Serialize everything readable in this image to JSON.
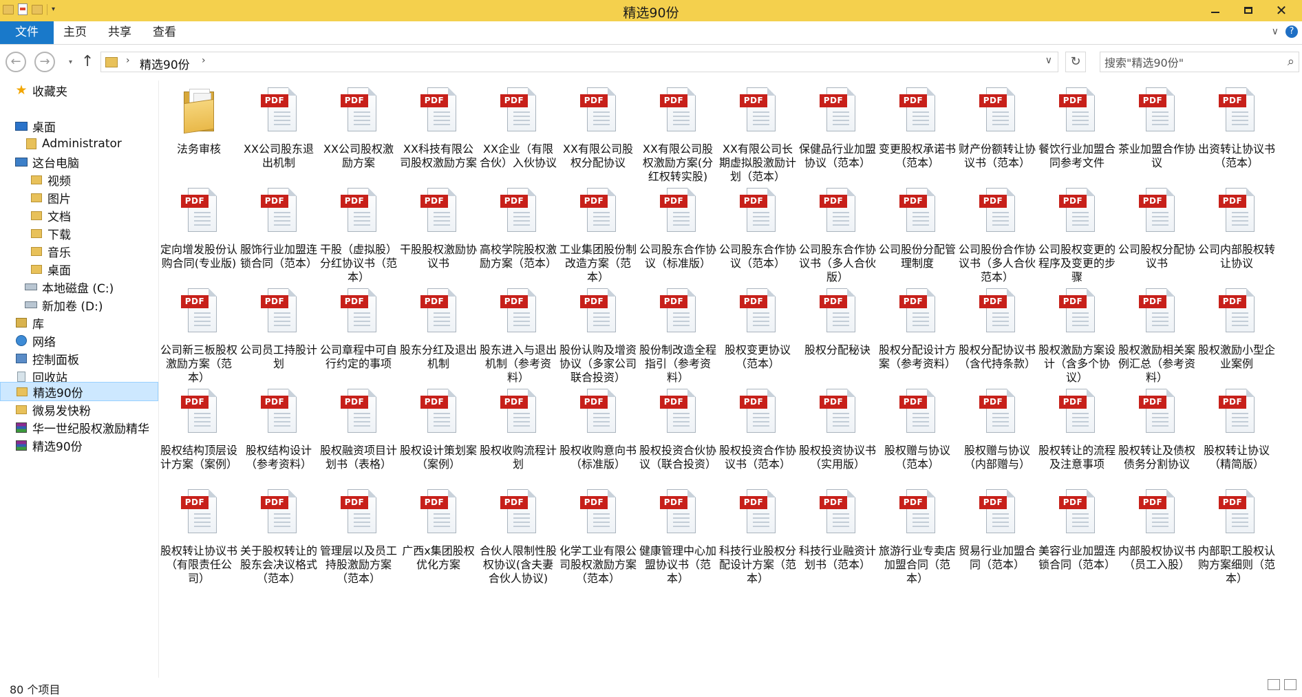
{
  "window": {
    "title": "精选90份",
    "controls": {
      "minimize": "—",
      "maximize": "❐",
      "close": "✕"
    }
  },
  "ribbon": {
    "tabs": [
      "文件",
      "主页",
      "共享",
      "查看"
    ]
  },
  "address": {
    "crumb": "精选90份",
    "search_placeholder": "搜索\"精选90份\""
  },
  "sidebar": {
    "items": [
      {
        "label": "收藏夹",
        "icon": "star-icon"
      },
      {
        "label": "桌面",
        "icon": "desktop-icon"
      },
      {
        "label": "Administrator",
        "icon": "user-folder-icon"
      },
      {
        "label": "这台电脑",
        "icon": "computer-icon"
      },
      {
        "label": "视频",
        "icon": "videos-folder-icon"
      },
      {
        "label": "图片",
        "icon": "pictures-folder-icon"
      },
      {
        "label": "文档",
        "icon": "documents-folder-icon"
      },
      {
        "label": "下载",
        "icon": "downloads-folder-icon"
      },
      {
        "label": "音乐",
        "icon": "music-folder-icon"
      },
      {
        "label": "桌面",
        "icon": "desktop-folder-icon"
      },
      {
        "label": "本地磁盘 (C:)",
        "icon": "local-disk-icon"
      },
      {
        "label": "新加卷 (D:)",
        "icon": "drive-icon"
      },
      {
        "label": "库",
        "icon": "library-icon"
      },
      {
        "label": "网络",
        "icon": "network-icon"
      },
      {
        "label": "控制面板",
        "icon": "control-panel-icon"
      },
      {
        "label": "回收站",
        "icon": "recycle-bin-icon"
      },
      {
        "label": "精选90份",
        "icon": "folder-icon",
        "selected": true
      },
      {
        "label": "微易发快粉",
        "icon": "folder-icon"
      },
      {
        "label": "华一世纪股权激励精华",
        "icon": "archive-icon"
      },
      {
        "label": "精选90份",
        "icon": "archive-icon"
      }
    ]
  },
  "files": [
    {
      "label": "法务审核",
      "type": "folder"
    },
    {
      "label": "XX公司股东退出机制",
      "type": "pdf"
    },
    {
      "label": "XX公司股权激励方案",
      "type": "pdf"
    },
    {
      "label": "XX科技有限公司股权激励方案",
      "type": "pdf"
    },
    {
      "label": "XX企业（有限合伙）入伙协议",
      "type": "pdf"
    },
    {
      "label": "XX有限公司股权分配协议",
      "type": "pdf"
    },
    {
      "label": "XX有限公司股权激励方案(分红权转实股)",
      "type": "pdf"
    },
    {
      "label": "XX有限公司长期虚拟股激励计划（范本）",
      "type": "pdf"
    },
    {
      "label": "保健品行业加盟协议（范本）",
      "type": "pdf"
    },
    {
      "label": "变更股权承诺书（范本）",
      "type": "pdf"
    },
    {
      "label": "财产份额转让协议书（范本）",
      "type": "pdf"
    },
    {
      "label": "餐饮行业加盟合同参考文件",
      "type": "pdf"
    },
    {
      "label": "茶业加盟合作协议",
      "type": "pdf"
    },
    {
      "label": "出资转让协议书（范本）",
      "type": "pdf"
    },
    {
      "label": "定向增发股份认购合同(专业版)",
      "type": "pdf"
    },
    {
      "label": "服饰行业加盟连锁合同（范本）",
      "type": "pdf"
    },
    {
      "label": "干股（虚拟股）分红协议书（范本）",
      "type": "pdf"
    },
    {
      "label": "干股股权激励协议书",
      "type": "pdf"
    },
    {
      "label": "高校学院股权激励方案（范本）",
      "type": "pdf"
    },
    {
      "label": "工业集团股份制改造方案（范本）",
      "type": "pdf"
    },
    {
      "label": "公司股东合作协议（标准版）",
      "type": "pdf"
    },
    {
      "label": "公司股东合作协议（范本）",
      "type": "pdf"
    },
    {
      "label": "公司股东合作协议书（多人合伙版）",
      "type": "pdf"
    },
    {
      "label": "公司股份分配管理制度",
      "type": "pdf"
    },
    {
      "label": "公司股份合作协议书（多人合伙范本）",
      "type": "pdf"
    },
    {
      "label": "公司股权变更的程序及变更的步骤",
      "type": "pdf"
    },
    {
      "label": "公司股权分配协议书",
      "type": "pdf"
    },
    {
      "label": "公司内部股权转让协议",
      "type": "pdf"
    },
    {
      "label": "公司新三板股权激励方案（范本）",
      "type": "pdf"
    },
    {
      "label": "公司员工持股计划",
      "type": "pdf"
    },
    {
      "label": "公司章程中可自行约定的事项",
      "type": "pdf"
    },
    {
      "label": "股东分红及退出机制",
      "type": "pdf"
    },
    {
      "label": "股东进入与退出机制（参考资料）",
      "type": "pdf"
    },
    {
      "label": "股份认购及增资协议（多家公司联合投资）",
      "type": "pdf"
    },
    {
      "label": "股份制改造全程指引（参考资料）",
      "type": "pdf"
    },
    {
      "label": "股权变更协议（范本）",
      "type": "pdf"
    },
    {
      "label": "股权分配秘诀",
      "type": "pdf"
    },
    {
      "label": "股权分配设计方案（参考资料）",
      "type": "pdf"
    },
    {
      "label": "股权分配协议书（含代持条款）",
      "type": "pdf"
    },
    {
      "label": "股权激励方案设计（含多个协议）",
      "type": "pdf"
    },
    {
      "label": "股权激励相关案例汇总（参考资料）",
      "type": "pdf"
    },
    {
      "label": "股权激励小型企业案例",
      "type": "pdf"
    },
    {
      "label": "股权结构顶层设计方案（案例）",
      "type": "pdf"
    },
    {
      "label": "股权结构设计（参考资料）",
      "type": "pdf"
    },
    {
      "label": "股权融资项目计划书（表格）",
      "type": "pdf"
    },
    {
      "label": "股权设计策划案（案例）",
      "type": "pdf"
    },
    {
      "label": "股权收购流程计划",
      "type": "pdf"
    },
    {
      "label": "股权收购意向书（标准版）",
      "type": "pdf"
    },
    {
      "label": "股权投资合伙协议（联合投资）",
      "type": "pdf"
    },
    {
      "label": "股权投资合作协议书（范本）",
      "type": "pdf"
    },
    {
      "label": "股权投资协议书（实用版）",
      "type": "pdf"
    },
    {
      "label": "股权赠与协议（范本）",
      "type": "pdf"
    },
    {
      "label": "股权赠与协议（内部赠与）",
      "type": "pdf"
    },
    {
      "label": "股权转让的流程及注意事项",
      "type": "pdf"
    },
    {
      "label": "股权转让及债权债务分割协议",
      "type": "pdf"
    },
    {
      "label": "股权转让协议（精简版）",
      "type": "pdf"
    },
    {
      "label": "股权转让协议书（有限责任公司）",
      "type": "pdf"
    },
    {
      "label": "关于股权转让的股东会决议格式（范本）",
      "type": "pdf"
    },
    {
      "label": "管理层以及员工持股激励方案（范本）",
      "type": "pdf"
    },
    {
      "label": "广西x集团股权优化方案",
      "type": "pdf"
    },
    {
      "label": "合伙人限制性股权协议(含夫妻合伙人协议)",
      "type": "pdf"
    },
    {
      "label": "化学工业有限公司股权激励方案（范本）",
      "type": "pdf"
    },
    {
      "label": "健康管理中心加盟协议书（范本）",
      "type": "pdf"
    },
    {
      "label": "科技行业股权分配设计方案（范本）",
      "type": "pdf"
    },
    {
      "label": "科技行业融资计划书（范本）",
      "type": "pdf"
    },
    {
      "label": "旅游行业专卖店加盟合同（范本）",
      "type": "pdf"
    },
    {
      "label": "贸易行业加盟合同（范本）",
      "type": "pdf"
    },
    {
      "label": "美容行业加盟连锁合同（范本）",
      "type": "pdf"
    },
    {
      "label": "内部股权协议书（员工入股）",
      "type": "pdf"
    },
    {
      "label": "内部职工股权认购方案细则（范本）",
      "type": "pdf"
    }
  ],
  "status": {
    "count": "80 个项目"
  },
  "icons": {
    "pdf_badge": "PDF",
    "back": "←",
    "forward": "→",
    "up": "↑",
    "refresh": "↻",
    "search": "⚲",
    "chevron": "›",
    "dropdown": "∨"
  },
  "colors": {
    "titlebar": "#f4d04d",
    "file_tab": "#1979ca",
    "pdf_badge": "#c7201a",
    "selection": "#cde8ff"
  }
}
